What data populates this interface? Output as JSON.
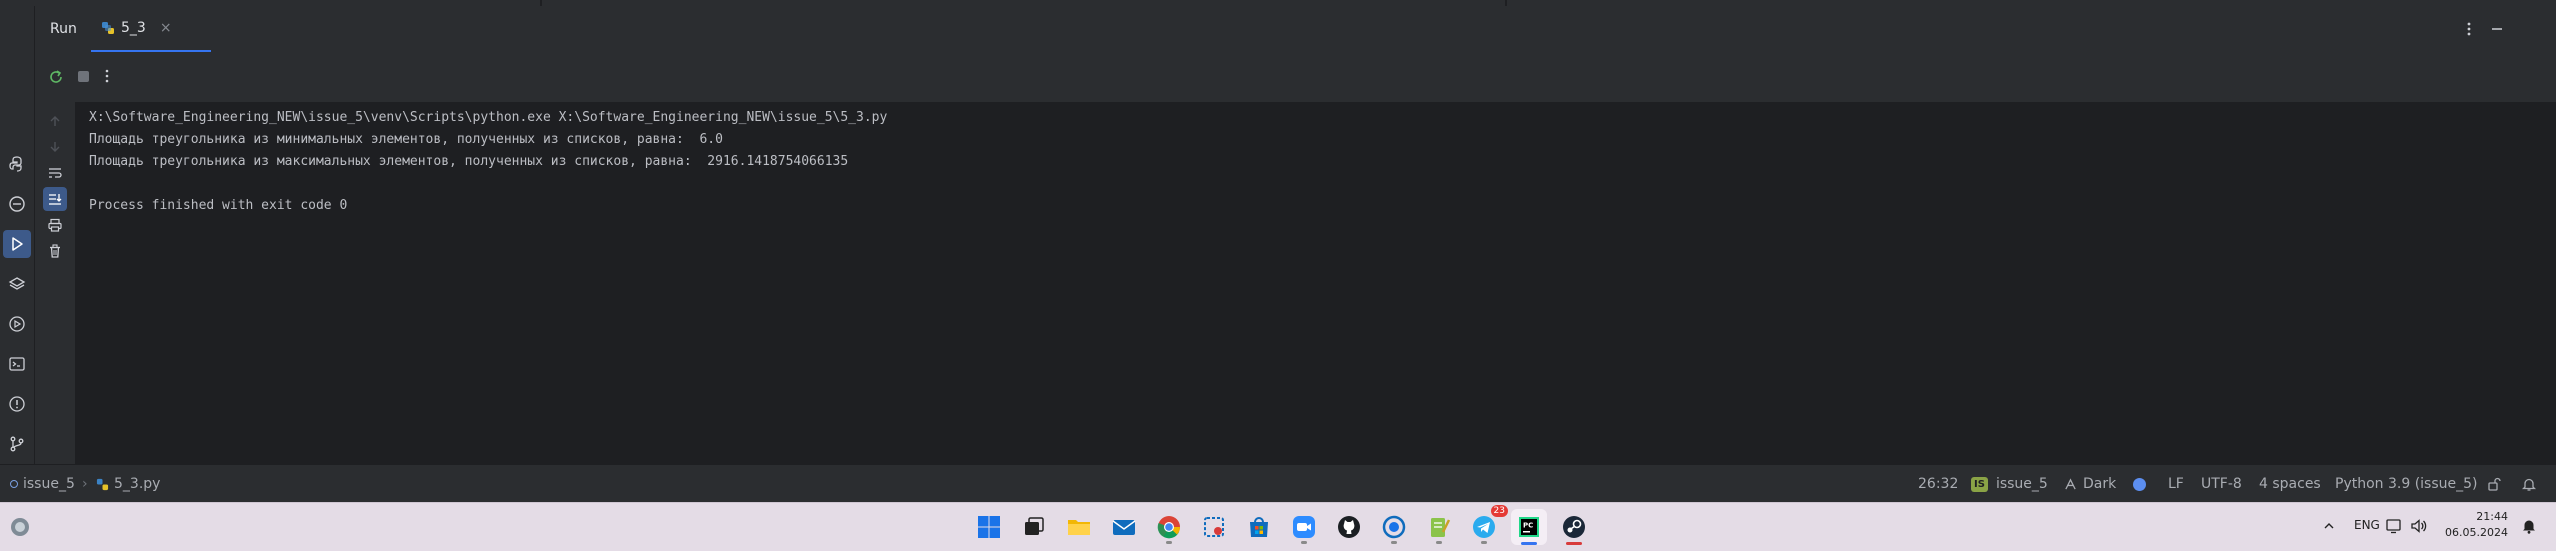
{
  "run_panel": {
    "title": "Run",
    "tab": {
      "label": "5_3",
      "close": "×"
    }
  },
  "console": {
    "lines": [
      "X:\\Software_Engineering_NEW\\issue_5\\venv\\Scripts\\python.exe X:\\Software_Engineering_NEW\\issue_5\\5_3.py",
      "Площадь треугольника из минимальных элементов, полученных из списков, равна:  6.0",
      "Площадь треугольника из максимальных элементов, полученных из списков, равна:  2916.1418754066135",
      "",
      "Process finished with exit code 0"
    ]
  },
  "status_bar": {
    "project": "issue_5",
    "file": "5_3.py",
    "position": "26:32",
    "vcs_badge": "IS",
    "vcs_branch": "issue_5",
    "theme": "Dark",
    "line_ending": "LF",
    "encoding": "UTF-8",
    "indent": "4 spaces",
    "interpreter": "Python 3.9 (issue_5)"
  },
  "taskbar": {
    "language": "ENG",
    "time": "21:44",
    "date": "06.05.2024",
    "badge_count": "23"
  },
  "colors": {
    "accent": "#3574f0",
    "panel": "#2b2d30",
    "editor_bg": "#1e1f22",
    "text": "#bcbec4",
    "taskbar": "#e4dce6"
  }
}
